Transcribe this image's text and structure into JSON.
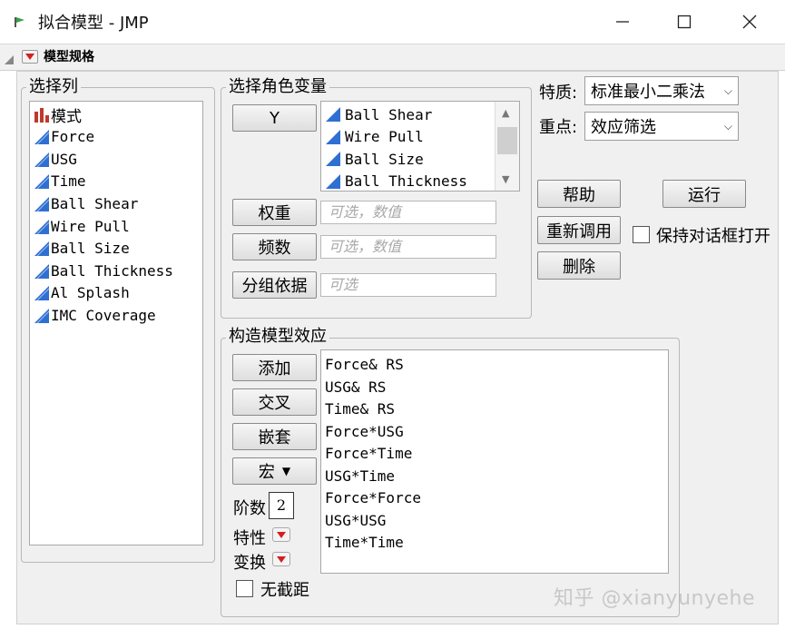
{
  "window": {
    "title": "拟合模型 - JMP",
    "controls": [
      "minimize",
      "maximize",
      "close"
    ]
  },
  "outline": {
    "label": "模型规格"
  },
  "select_columns": {
    "legend": "选择列",
    "items": [
      {
        "label": "模式",
        "icon": "bar-chart-icon",
        "color": "#c0392b"
      },
      {
        "label": "Force",
        "icon": "continuous-icon",
        "color": "#2f6fd1"
      },
      {
        "label": "USG",
        "icon": "continuous-icon",
        "color": "#2f6fd1"
      },
      {
        "label": "Time",
        "icon": "continuous-icon",
        "color": "#2f6fd1"
      },
      {
        "label": "Ball Shear",
        "icon": "continuous-icon",
        "color": "#2f6fd1"
      },
      {
        "label": "Wire Pull",
        "icon": "continuous-icon",
        "color": "#2f6fd1"
      },
      {
        "label": "Ball Size",
        "icon": "continuous-icon",
        "color": "#2f6fd1"
      },
      {
        "label": "Ball Thickness",
        "icon": "continuous-icon",
        "color": "#2f6fd1"
      },
      {
        "label": "Al Splash",
        "icon": "continuous-icon",
        "color": "#2f6fd1"
      },
      {
        "label": "IMC Coverage",
        "icon": "continuous-icon",
        "color": "#2f6fd1"
      }
    ]
  },
  "roles": {
    "legend": "选择角色变量",
    "y_button": "Y",
    "y_list": [
      "Ball Shear",
      "Wire Pull",
      "Ball Size",
      "Ball Thickness"
    ],
    "weight_button": "权重",
    "weight_placeholder": "可选，数值",
    "freq_button": "频数",
    "freq_placeholder": "可选，数值",
    "by_button": "分组依据",
    "by_placeholder": "可选"
  },
  "personality": {
    "label": "特质:",
    "value": "标准最小二乘法"
  },
  "emphasis": {
    "label": "重点:",
    "value": "效应筛选"
  },
  "actions": {
    "help": "帮助",
    "run": "运行",
    "recall": "重新调用",
    "keep_dialog": "保持对话框打开",
    "remove": "删除"
  },
  "effects": {
    "legend": "构造模型效应",
    "add": "添加",
    "cross": "交叉",
    "nest": "嵌套",
    "macros": "宏",
    "degree_label": "阶数",
    "degree_value": "2",
    "attributes_label": "特性",
    "transform_label": "变换",
    "no_intercept": "无截距",
    "list": [
      "Force& RS",
      "USG& RS",
      "Time& RS",
      "Force*USG",
      "Force*Time",
      "USG*Time",
      "Force*Force",
      "USG*USG",
      "Time*Time"
    ]
  },
  "watermark": "知乎 @xianyunyehe"
}
